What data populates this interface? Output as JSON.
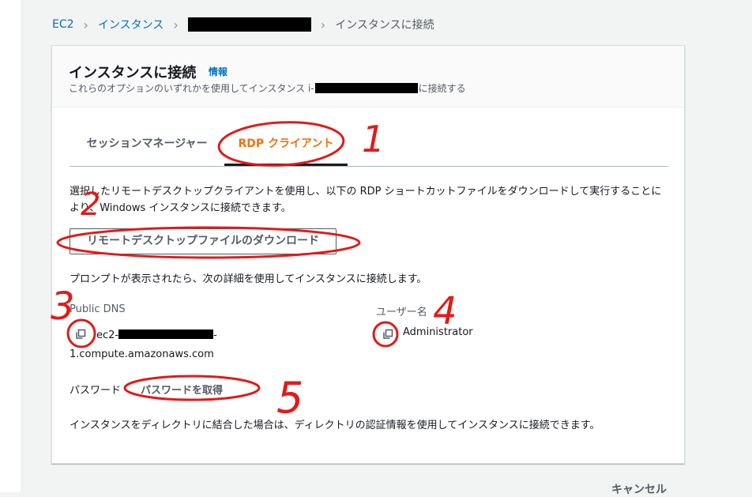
{
  "breadcrumb": {
    "ec2": "EC2",
    "instances": "インスタンス",
    "current": "インスタンスに接続"
  },
  "panel": {
    "title": "インスタンスに接続",
    "info_link": "情報",
    "description_before": "これらのオプションのいずれかを使用してインスタンス i-",
    "description_after": "に接続する"
  },
  "tabs": [
    {
      "label": "セッションマネージャー",
      "selected": false
    },
    {
      "label": "RDP クライアント",
      "selected": true
    }
  ],
  "rdp": {
    "description": "選択したリモートデスクトップクライアントを使用し、以下の RDP ショートカットファイルをダウンロードして実行することにより、Windows インスタンスに接続できます。",
    "download_button": "リモートデスクトップファイルのダウンロード",
    "prompt_text": "プロンプトが表示されたら、次の詳細を使用してインスタンスに接続します。",
    "public_dns_label": "Public DNS",
    "public_dns_prefix": "ec2-",
    "public_dns_middle": "-",
    "public_dns_suffix": "1.compute.amazonaws.com",
    "username_label": "ユーザー名",
    "username_value": "Administrator",
    "password_label": "パスワード",
    "password_link": "パスワードを取得",
    "directory_text": "インスタンスをディレクトリに結合した場合は、ディレクトリの認証情報を使用してインスタンスに接続できます。"
  },
  "footer": {
    "cancel": "キャンセル"
  },
  "annotations": {
    "numbers": [
      "1",
      "2",
      "3",
      "4",
      "5"
    ],
    "color": "#e01b1b"
  },
  "colors": {
    "link": "#0073bb",
    "active_tab": "#ec7211",
    "background": "#f2f3f3"
  },
  "icons": [
    "chevron-right-icon",
    "copy-icon"
  ]
}
